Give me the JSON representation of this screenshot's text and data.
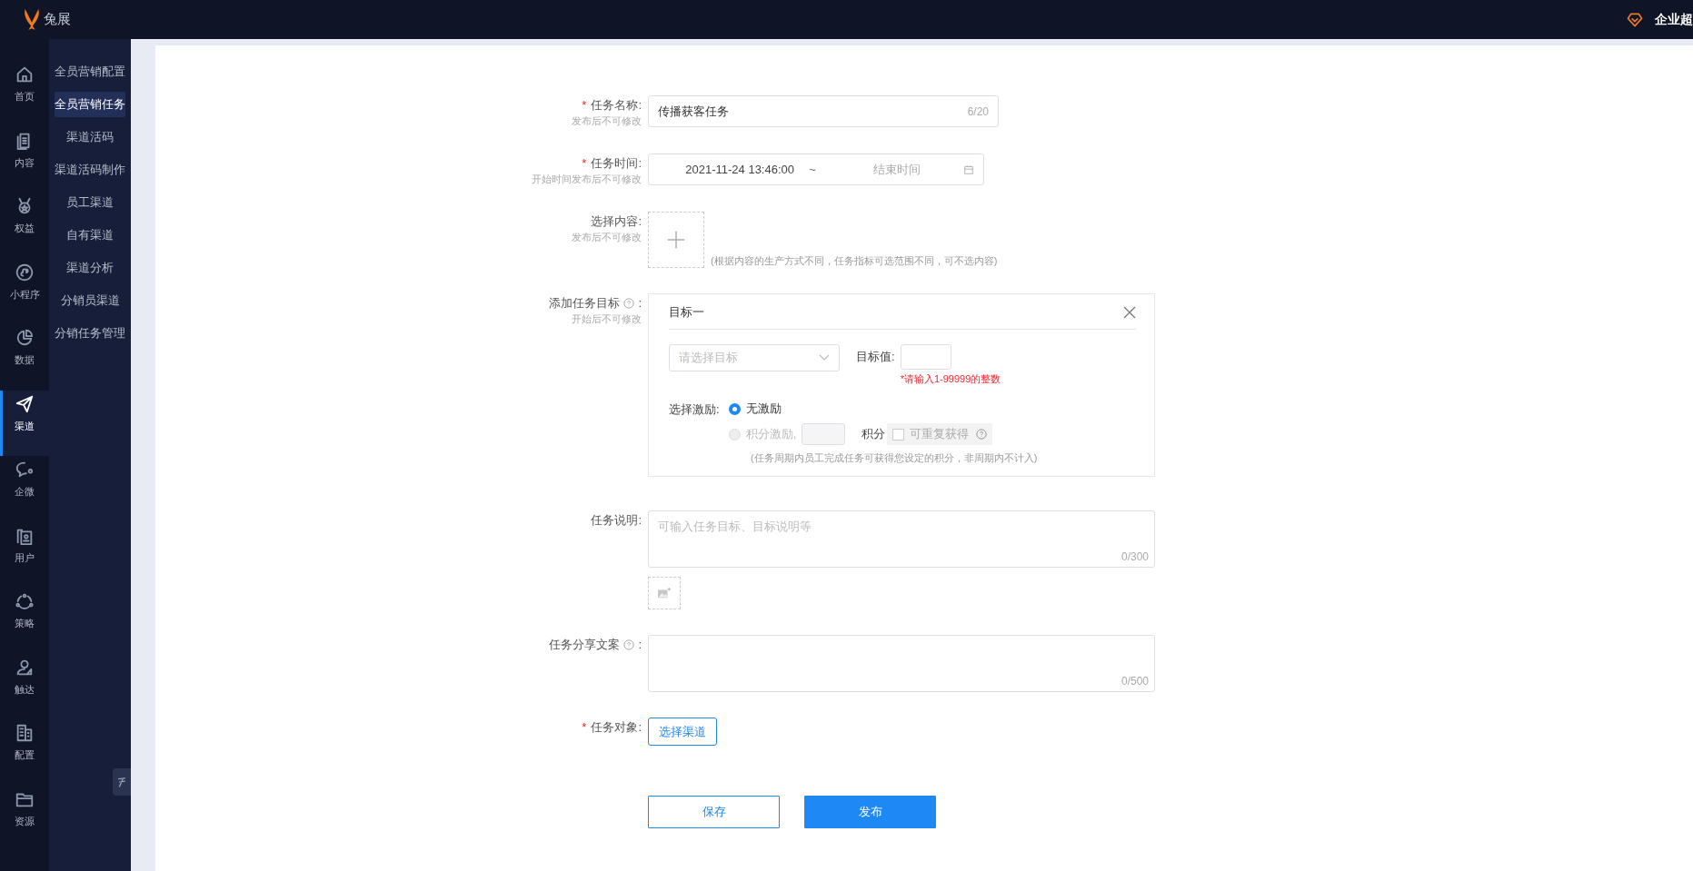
{
  "header": {
    "logo_text": "兔展",
    "user": "企业超"
  },
  "rail": [
    {
      "label": "首页",
      "selected": false
    },
    {
      "label": "内容",
      "selected": false
    },
    {
      "label": "权益",
      "selected": false
    },
    {
      "label": "小程序",
      "selected": false
    },
    {
      "label": "数据",
      "selected": false
    },
    {
      "label": "渠道",
      "selected": true
    },
    {
      "label": "企微",
      "selected": false
    },
    {
      "label": "用户",
      "selected": false
    },
    {
      "label": "策略",
      "selected": false
    },
    {
      "label": "触达",
      "selected": false
    },
    {
      "label": "配置",
      "selected": false
    },
    {
      "label": "资源",
      "selected": false
    }
  ],
  "submenu": [
    {
      "label": "全员营销配置",
      "selected": false
    },
    {
      "label": "全员营销任务",
      "selected": true
    },
    {
      "label": "渠道活码",
      "selected": false
    },
    {
      "label": "渠道活码制作",
      "selected": false
    },
    {
      "label": "员工渠道",
      "selected": false
    },
    {
      "label": "自有渠道",
      "selected": false
    },
    {
      "label": "渠道分析",
      "selected": false
    },
    {
      "label": "分销员渠道",
      "selected": false
    },
    {
      "label": "分销任务管理",
      "selected": false
    }
  ],
  "fields": [
    {
      "kind": "text",
      "required_mark": "*",
      "label": "任务名称:",
      "hint": "发布后不可修改",
      "value": "传播获客任务",
      "counter": "6/20"
    },
    {
      "kind": "daterange",
      "required_mark": "*",
      "label": "任务时间:",
      "hint": "开始时间发布后不可修改",
      "start": "2021-11-24 13:46:00",
      "separator": "~",
      "end_placeholder": "结束时间"
    },
    {
      "kind": "upload",
      "label": "选择内容:",
      "hint": "发布后不可修改",
      "note": "(根据内容的生产方式不同，任务指标可选范围不同，可不选内容)"
    },
    {
      "kind": "goals",
      "label": "添加任务目标",
      "help": true,
      "colon": ":",
      "hint": "开始后不可修改",
      "goals": [
        {
          "title": "目标一",
          "select_placeholder": "请选择目标",
          "value_label": "目标值:",
          "error": "*请输入1-99999的整数",
          "incentive_label": "选择激励:",
          "options": [
            {
              "label": "无激励",
              "selected": true,
              "disabled": false
            },
            {
              "label": "积分激励,",
              "selected": false,
              "disabled": true
            }
          ],
          "points_unit": "积分",
          "repeat": {
            "label": "可重复获得",
            "checked": false,
            "disabled": true
          },
          "note": "(任务周期内员工完成任务可获得您设定的积分，非周期内不计入)"
        }
      ]
    },
    {
      "kind": "textarea",
      "label": "任务说明:",
      "placeholder": "可输入任务目标、目标说明等",
      "counter": "0/300",
      "image_upload": true
    },
    {
      "kind": "textarea",
      "label": "任务分享文案",
      "help": true,
      "colon": ":",
      "counter": "0/500",
      "image_upload": false
    },
    {
      "kind": "picker",
      "required_mark": "*",
      "label": "任务对象:",
      "button": "选择渠道"
    }
  ],
  "actions": [
    {
      "label": "保存",
      "kind": "secondary"
    },
    {
      "label": "发布",
      "kind": "primary"
    }
  ]
}
